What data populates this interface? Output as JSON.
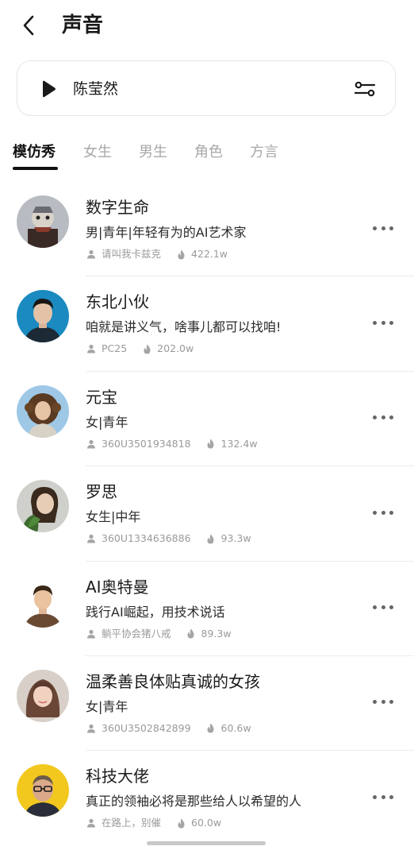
{
  "header": {
    "title": "声音"
  },
  "player": {
    "name": "陈莹然"
  },
  "tabs": [
    {
      "label": "模仿秀",
      "active": true
    },
    {
      "label": "女生",
      "active": false
    },
    {
      "label": "男生",
      "active": false
    },
    {
      "label": "角色",
      "active": false
    },
    {
      "label": "方言",
      "active": false
    }
  ],
  "items": [
    {
      "name": "数字生命",
      "desc": "男|青年|年轻有为的AI艺术家",
      "author": "请叫我卡兹克",
      "plays": "422.1w"
    },
    {
      "name": "东北小伙",
      "desc": "咱就是讲义气，啥事儿都可以找咱!",
      "author": "PC25",
      "plays": "202.0w"
    },
    {
      "name": "元宝",
      "desc": "女|青年",
      "author": "360U3501934818",
      "plays": "132.4w"
    },
    {
      "name": "罗思",
      "desc": "女生|中年",
      "author": "360U1334636886",
      "plays": "93.3w"
    },
    {
      "name": "AI奥特曼",
      "desc": "践行AI崛起，用技术说话",
      "author": "躺平协会猪八戒",
      "plays": "89.3w"
    },
    {
      "name": "温柔善良体贴真诚的女孩",
      "desc": "女|青年",
      "author": "360U3502842899",
      "plays": "60.6w"
    },
    {
      "name": "科技大佬",
      "desc": "真正的领袖必将是那些给人以希望的人",
      "author": "在路上，别催",
      "plays": "60.0w"
    }
  ],
  "colors": {
    "text": "#1a1a1a",
    "muted": "#9a9a9a",
    "inactive_tab": "#a8a8a8",
    "divider": "#ececec"
  },
  "icons": {
    "back": "chevron-left-icon",
    "play": "play-icon",
    "settings": "sliders-icon",
    "user": "user-icon",
    "fire": "flame-icon",
    "more": "more-dots-icon"
  }
}
